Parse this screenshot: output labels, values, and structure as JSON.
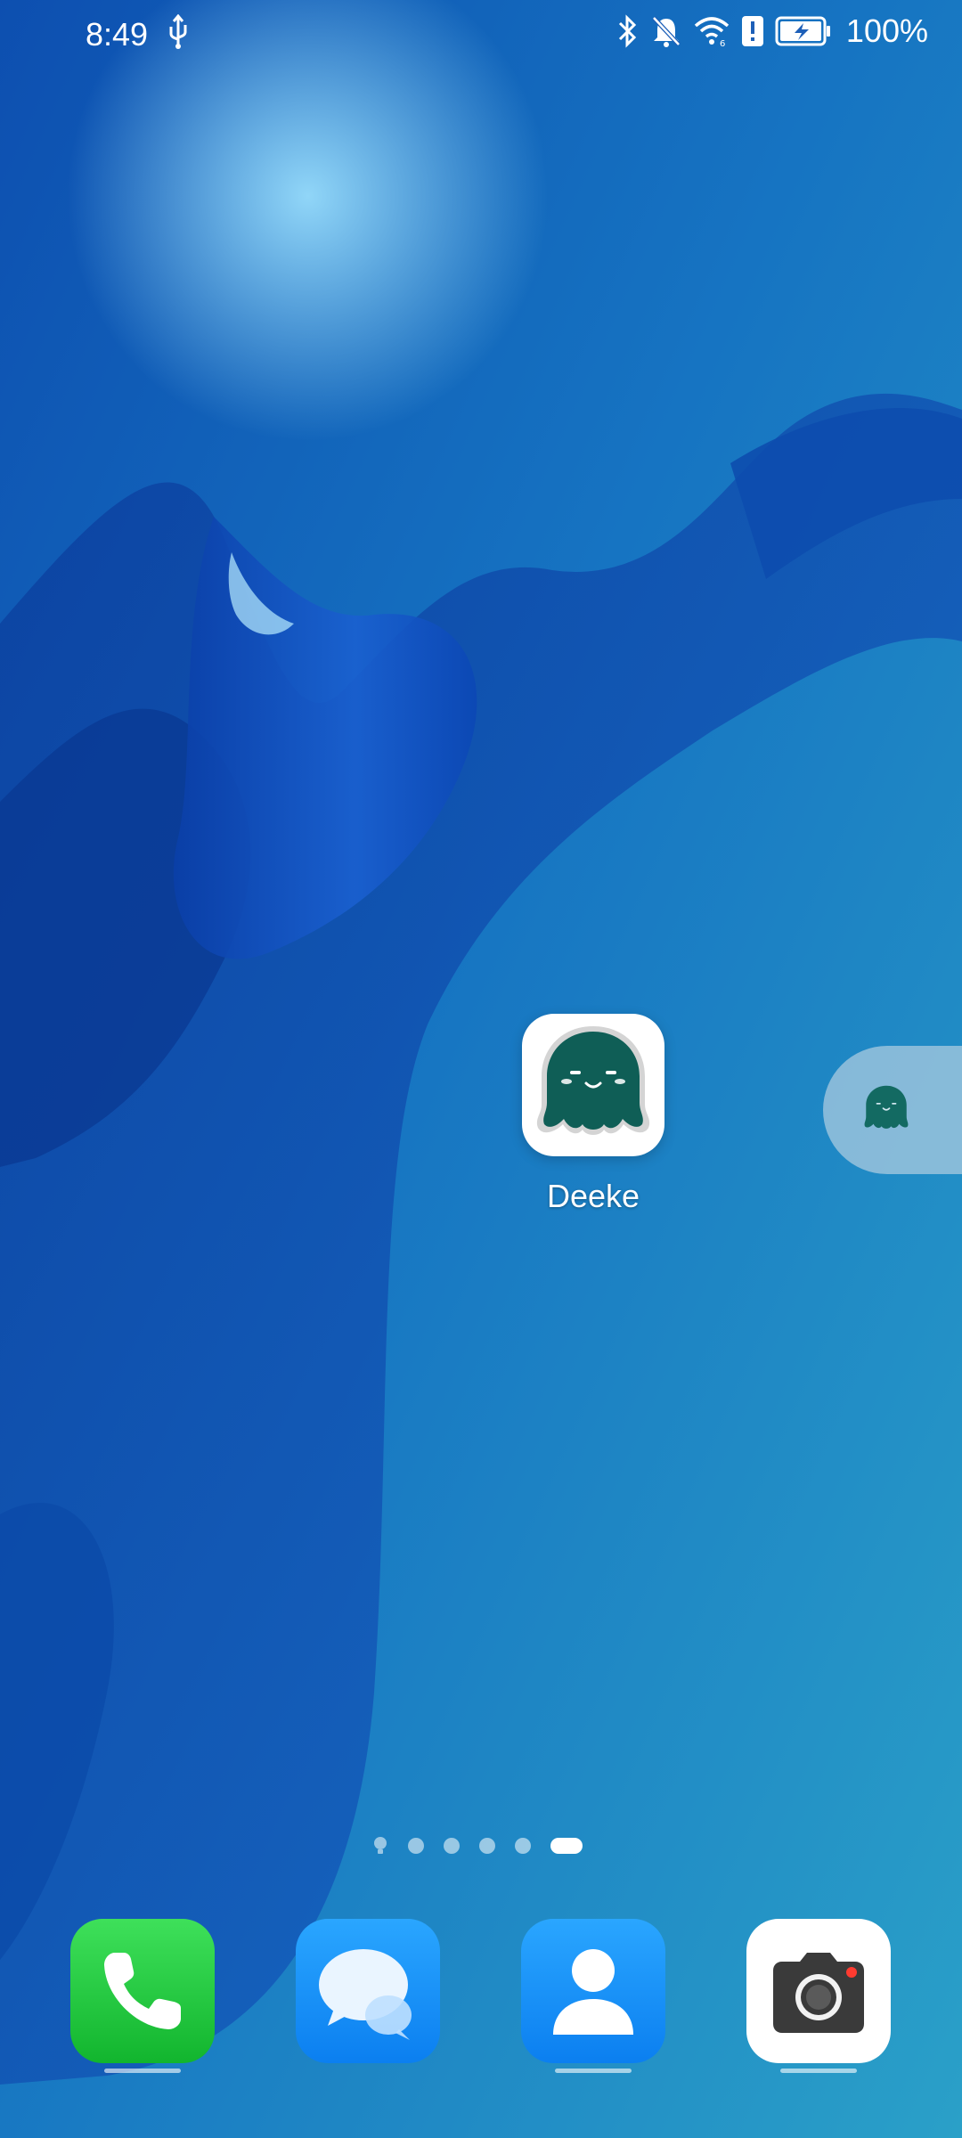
{
  "status_bar": {
    "time": "8:49",
    "battery_percent": "100%",
    "icons": [
      "usb-icon",
      "bluetooth-icon",
      "mute-bell-icon",
      "wifi-icon",
      "alert-icon",
      "battery-charging-icon"
    ]
  },
  "home_apps": [
    {
      "label": "Deeke",
      "icon": "octopus-icon"
    }
  ],
  "floating_assistant": {
    "icon": "octopus-icon"
  },
  "page_indicator": {
    "pages": 5,
    "current_page": 5,
    "first_is_hint": true
  },
  "dock": [
    {
      "app": "phone",
      "icon": "phone-icon",
      "color": "#1fc63a"
    },
    {
      "app": "messages",
      "icon": "message-bubbles-icon",
      "color": "#1a8fff"
    },
    {
      "app": "contacts",
      "icon": "person-icon",
      "color": "#1a8fff"
    },
    {
      "app": "camera",
      "icon": "camera-icon",
      "color": "#ffffff"
    }
  ],
  "colors": {
    "octopus": "#0f5e56",
    "accent_blue": "#1a8fff",
    "phone_green": "#1fc63a"
  }
}
